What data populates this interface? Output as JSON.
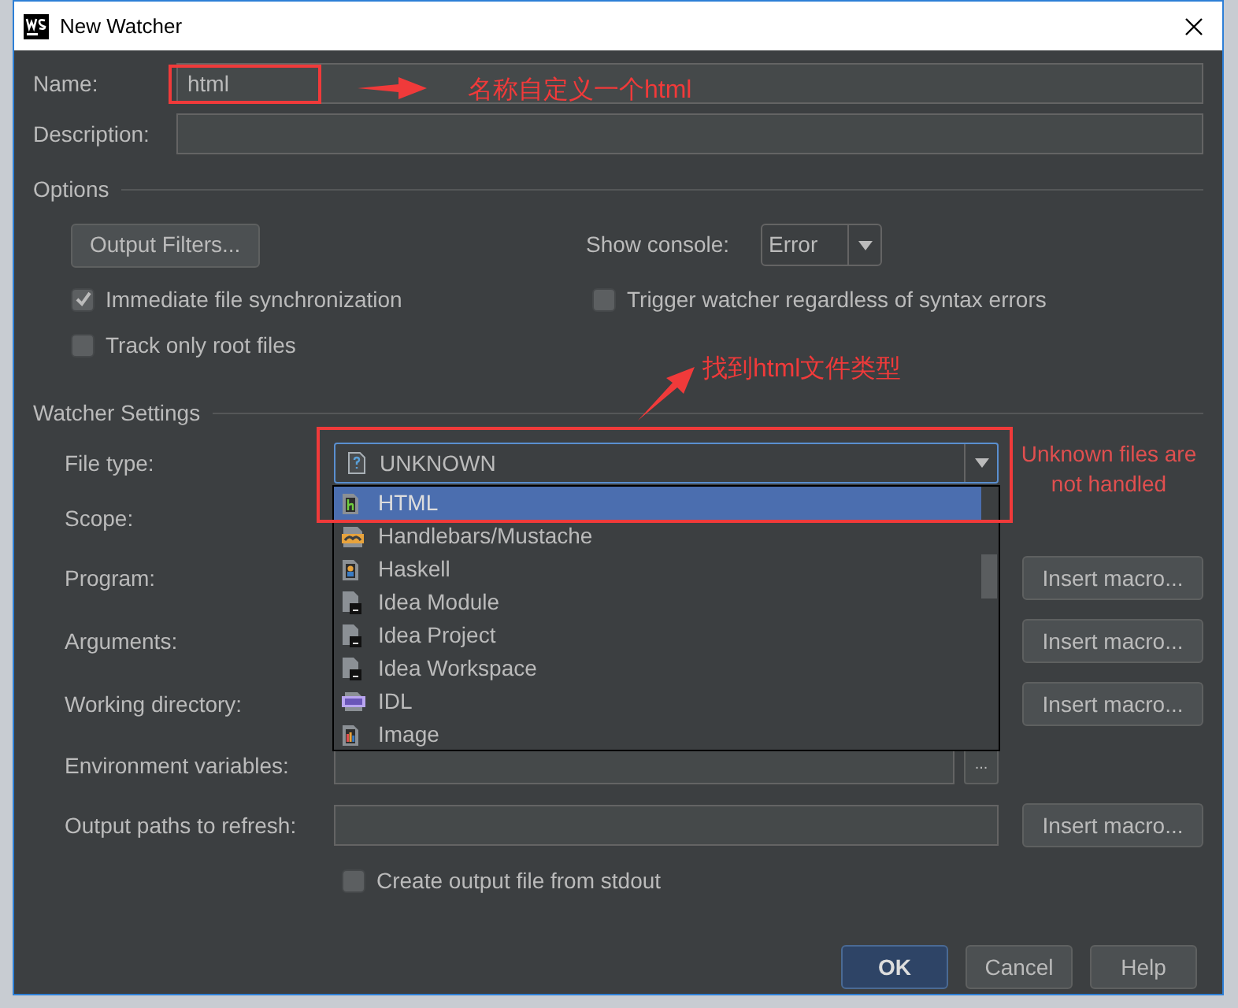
{
  "window": {
    "title": "New Watcher"
  },
  "fields": [
    {
      "label": "Name:",
      "value": "html"
    },
    {
      "label": "Description:"
    }
  ],
  "options": {
    "title": "Options",
    "output_filters": "Output Filters...",
    "show_console": {
      "label": "Show console:",
      "value": "Error"
    },
    "checkboxes": [
      {
        "label": "Immediate file synchronization",
        "checked": true
      },
      {
        "label": "Trigger watcher regardless of syntax errors",
        "checked": false
      },
      {
        "label": "Track only root files",
        "checked": false
      }
    ]
  },
  "watcher_settings": {
    "title": "Watcher Settings",
    "file_type": {
      "label": "File type:",
      "value": "UNKNOWN",
      "warning": "Unknown files are not handled",
      "options": [
        {
          "label": "HTML",
          "kind": "html",
          "selected": true
        },
        {
          "label": "Handlebars/Mustache",
          "kind": "handlebars",
          "selected": false
        },
        {
          "label": "Haskell",
          "kind": "haskell",
          "selected": false
        },
        {
          "label": "Idea Module",
          "kind": "idea",
          "selected": false
        },
        {
          "label": "Idea Project",
          "kind": "idea",
          "selected": false
        },
        {
          "label": "Idea Workspace",
          "kind": "idea",
          "selected": false
        },
        {
          "label": "IDL",
          "kind": "idl",
          "selected": false
        },
        {
          "label": "Image",
          "kind": "image",
          "selected": false
        }
      ]
    },
    "rows": [
      {
        "label": "Scope:",
        "kind": "plain"
      },
      {
        "label": "Program:",
        "kind": "macro",
        "button": "Insert macro..."
      },
      {
        "label": "Arguments:",
        "kind": "macro",
        "button": "Insert macro..."
      },
      {
        "label": "Working directory:",
        "kind": "macro",
        "button": "Insert macro..."
      },
      {
        "label": "Environment variables:",
        "kind": "browse",
        "button": "..."
      },
      {
        "label": "Output paths to refresh:",
        "kind": "macro",
        "button": "Insert macro..."
      }
    ],
    "create_output": {
      "label": "Create output file from stdout",
      "checked": false
    }
  },
  "buttons": [
    {
      "label": "OK",
      "default": true
    },
    {
      "label": "Cancel",
      "default": false
    },
    {
      "label": "Help",
      "default": false
    }
  ],
  "annotations": [
    {
      "text": "名称自定义一个html"
    },
    {
      "text": "找到html文件类型"
    }
  ]
}
